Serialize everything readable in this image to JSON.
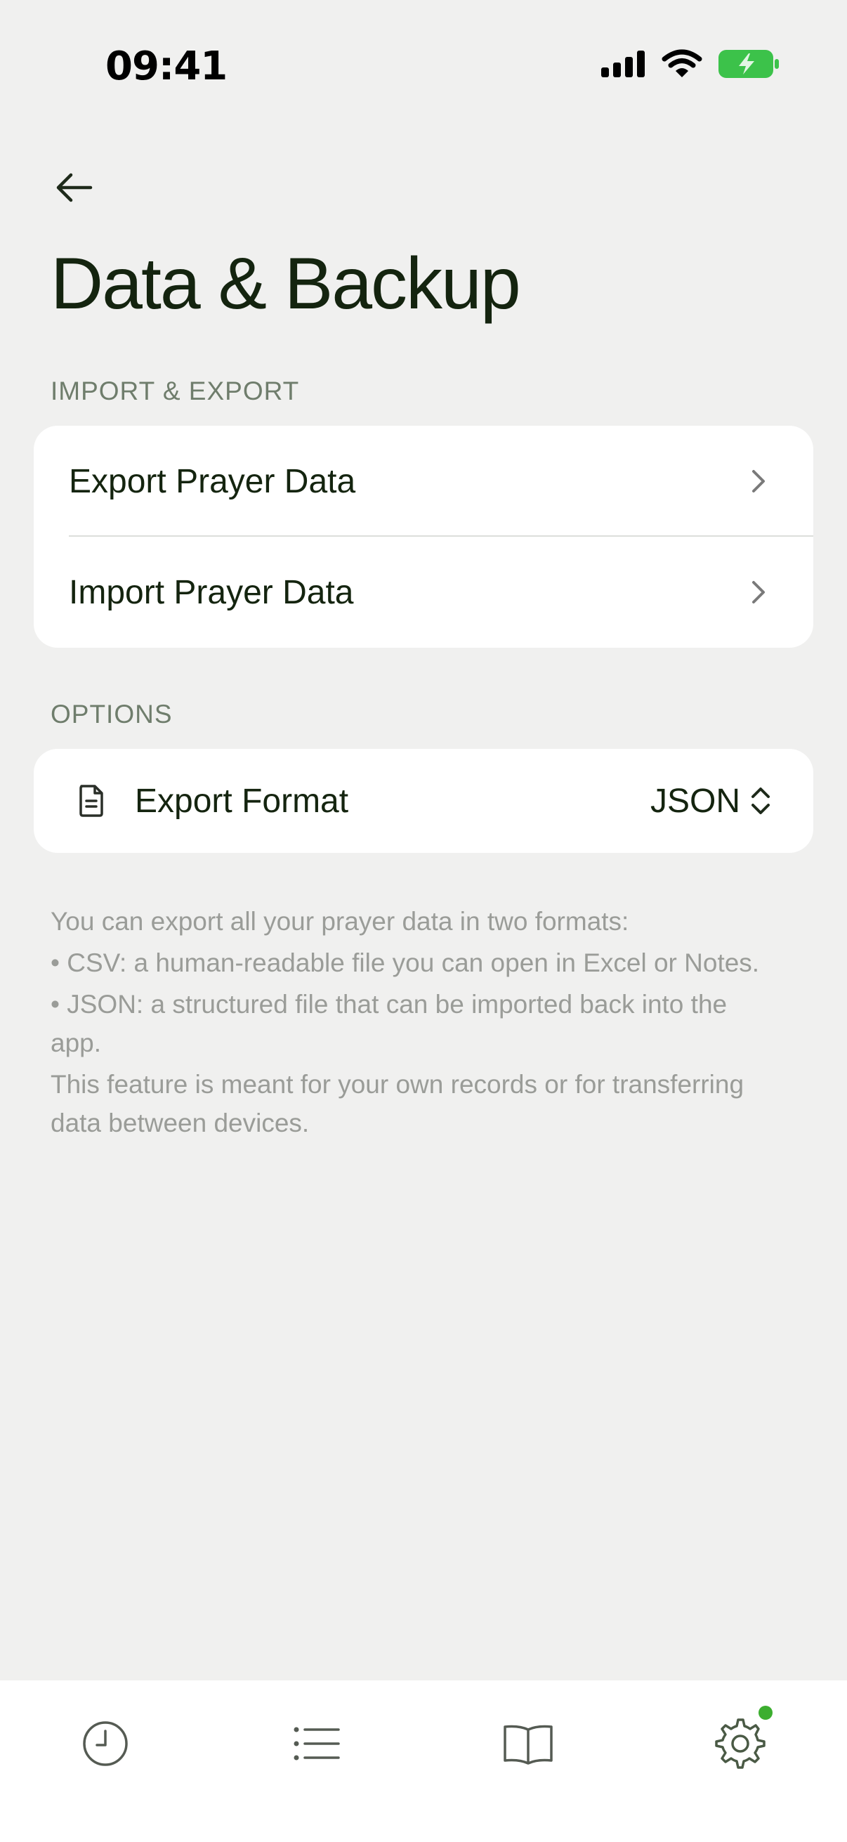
{
  "status_bar": {
    "time": "09:41"
  },
  "header": {
    "title": "Data & Backup"
  },
  "import_export": {
    "section_label": "IMPORT & EXPORT",
    "items": [
      {
        "label": "Export Prayer Data"
      },
      {
        "label": "Import Prayer Data"
      }
    ]
  },
  "options": {
    "section_label": "OPTIONS",
    "export_format": {
      "label": "Export Format",
      "value": "JSON"
    }
  },
  "description": {
    "lines": [
      "You can export all your prayer data in two formats:",
      "• CSV: a human-readable file you can open in Excel or Notes.",
      "• JSON: a structured file that can be imported back into the app.",
      "This feature is meant for your own records or for transferring data between devices."
    ]
  },
  "tab_bar": {
    "tabs": [
      {
        "icon": "clock-icon"
      },
      {
        "icon": "list-icon"
      },
      {
        "icon": "book-icon"
      },
      {
        "icon": "gear-icon",
        "badge": true
      }
    ]
  },
  "colors": {
    "background": "#f0f0ef",
    "text_primary": "#14240f",
    "section_header": "#6f7d6c",
    "description": "#9a9c98",
    "badge": "#3cae2f",
    "battery": "#3cc24a"
  }
}
